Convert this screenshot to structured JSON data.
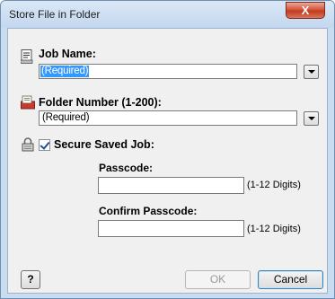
{
  "window": {
    "title": "Store File in Folder",
    "close_label": "X"
  },
  "job_name": {
    "label": "Job Name:",
    "value": "(Required)"
  },
  "folder_number": {
    "label": "Folder Number (1-200):",
    "value": "(Required)"
  },
  "secure": {
    "label": "Secure Saved Job:",
    "checked": true,
    "passcode_label": "Passcode:",
    "passcode_hint": "(1-12 Digits)",
    "confirm_label": "Confirm Passcode:",
    "confirm_hint": "(1-12 Digits)"
  },
  "buttons": {
    "help": "?",
    "ok": "OK",
    "cancel": "Cancel"
  },
  "icons": {
    "job": "document-icon",
    "folder": "folder-icon",
    "lock": "lock-icon"
  }
}
